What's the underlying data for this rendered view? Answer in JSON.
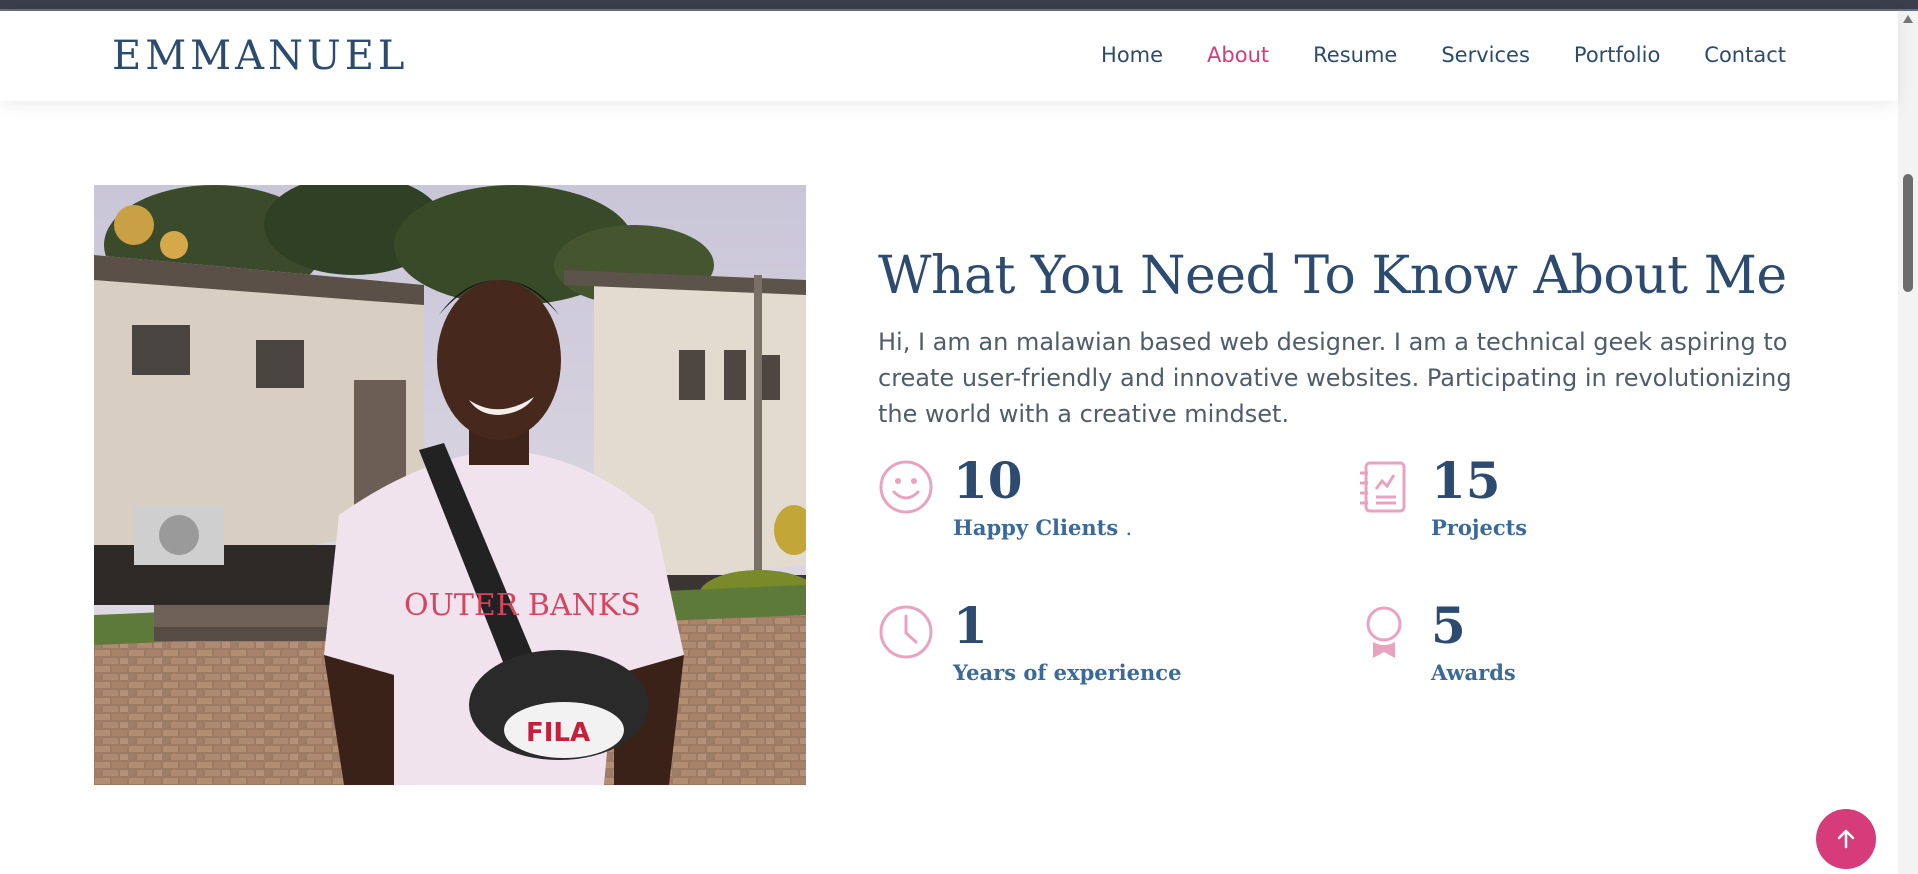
{
  "brand": {
    "logo_text": "EMMANUEL"
  },
  "nav": {
    "items": [
      {
        "label": "Home",
        "active": false
      },
      {
        "label": "About",
        "active": true
      },
      {
        "label": "Resume",
        "active": false
      },
      {
        "label": "Services",
        "active": false
      },
      {
        "label": "Portfolio",
        "active": false
      },
      {
        "label": "Contact",
        "active": false
      }
    ]
  },
  "about": {
    "title": "What You Need To Know About Me",
    "description": "Hi, I am an malawian based web designer. I am a technical geek aspiring to create user-friendly and innovative websites. Participating in revolutionizing the world with a creative mindset.",
    "stats": [
      {
        "icon": "smiley-icon",
        "value": "10",
        "label": "Happy Clients",
        "suffix": "."
      },
      {
        "icon": "journal-icon",
        "value": "15",
        "label": "Projects"
      },
      {
        "icon": "clock-icon",
        "value": "1",
        "label": "Years of experience"
      },
      {
        "icon": "award-icon",
        "value": "5",
        "label": "Awards"
      }
    ]
  },
  "colors": {
    "accent": "#d63b7a",
    "heading": "#2c4b6e",
    "label": "#3b6a98",
    "icon": "#e9a3c0"
  },
  "back_to_top": {
    "icon": "arrow-up-icon"
  }
}
